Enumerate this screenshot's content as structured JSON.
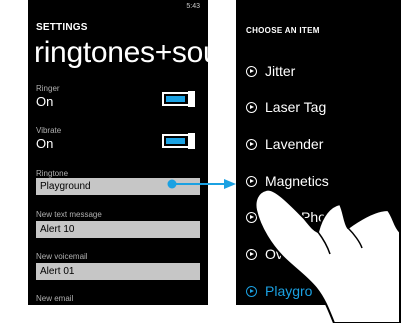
{
  "left_screen": {
    "status_time": "5:43",
    "section_label": "SETTINGS",
    "title": "ringtones+sounds",
    "ringer": {
      "caption": "Ringer",
      "value": "On"
    },
    "vibrate": {
      "caption": "Vibrate",
      "value": "On"
    },
    "ringtone": {
      "caption": "Ringtone",
      "value": "Playground"
    },
    "new_text_message": {
      "caption": "New text message",
      "value": "Alert 10"
    },
    "new_voicemail": {
      "caption": "New voicemail",
      "value": "Alert 01"
    },
    "new_email": {
      "caption": "New email"
    }
  },
  "right_screen": {
    "header": "CHOOSE AN ITEM",
    "items": [
      {
        "label": "Jitter"
      },
      {
        "label": "Laser Tag"
      },
      {
        "label": "Lavender"
      },
      {
        "label": "Magnetics"
      },
      {
        "label": "Phone"
      },
      {
        "label": "Ove"
      },
      {
        "label": "Playgro"
      }
    ],
    "selected_index": 6
  },
  "colors": {
    "accent": "#1ba1e2",
    "screen_background": "#000000",
    "field_background": "#c6c6c6"
  }
}
